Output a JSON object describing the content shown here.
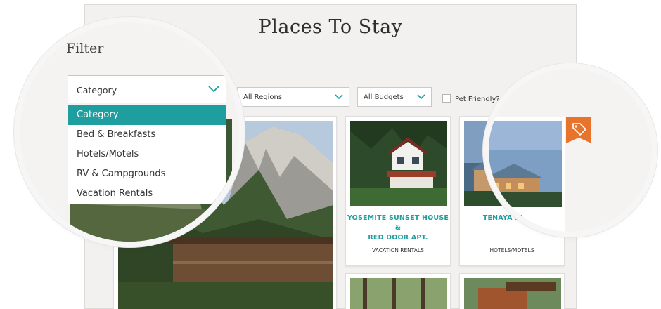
{
  "page": {
    "title": "Places To Stay"
  },
  "filter": {
    "label": "Filter",
    "category": {
      "selected": "Category",
      "options": [
        "Category",
        "Bed & Breakfasts",
        "Hotels/Motels",
        "RV & Campgrounds",
        "Vacation Rentals"
      ]
    },
    "region": {
      "selected": "All Regions"
    },
    "budget": {
      "selected": "All Budgets"
    },
    "pet_friendly": {
      "label": "Pet Friendly?",
      "checked": false
    }
  },
  "listings": [
    {
      "name_line1": "YOSEMITE SUNSET HOUSE &",
      "name_line2": "RED DOOR APT.",
      "category": "VACATION RENTALS"
    },
    {
      "name_line1": "TENAYA LODGE",
      "name_line2": "",
      "category": "HOTELS/MOTELS",
      "featured_icon": "tag-icon"
    }
  ],
  "colors": {
    "accent": "#1f9ea0",
    "featured_badge": "#e8742b"
  }
}
